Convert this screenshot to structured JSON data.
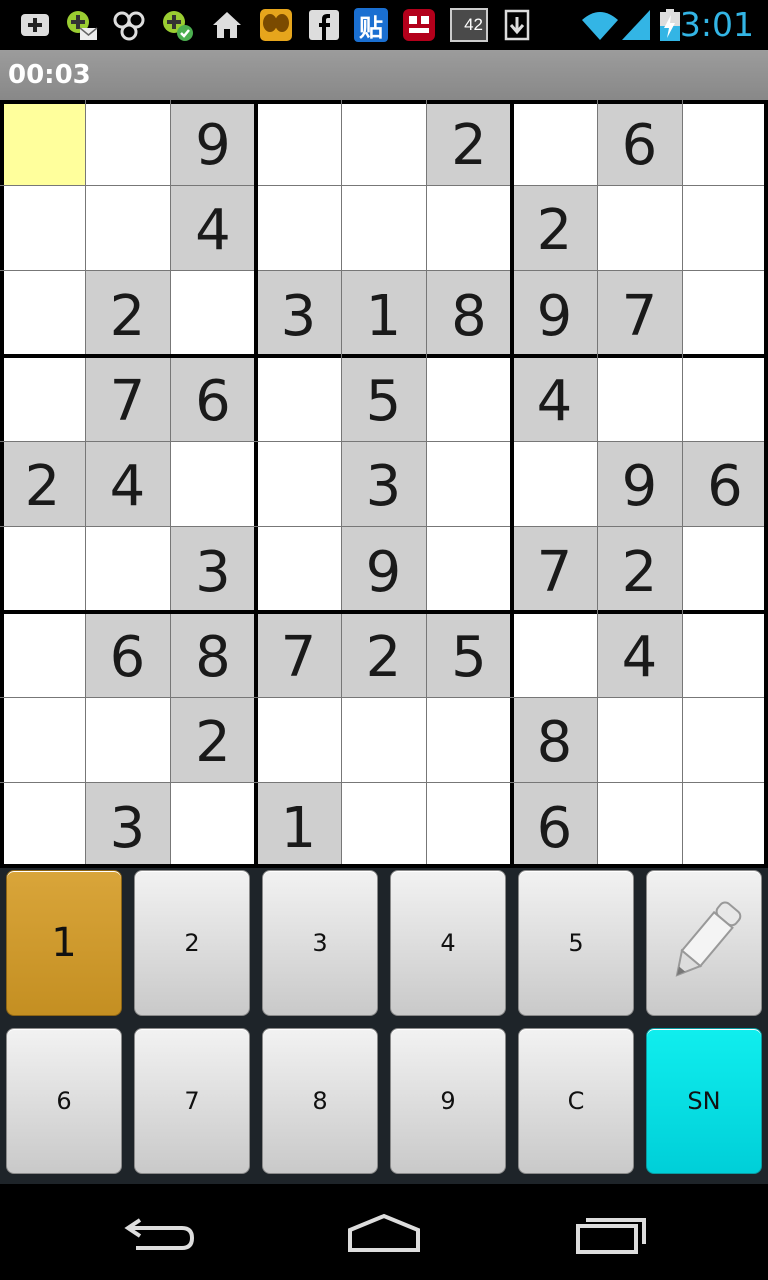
{
  "status_bar": {
    "time": "3:01",
    "notification_icons": [
      "add-box-icon",
      "android-mail-icon",
      "network-link-icon",
      "android-check-icon",
      "home-icon",
      "butterfly-app-icon",
      "facebook-icon",
      "tieba-app-icon",
      "netease-app-icon",
      "battery-widget-icon",
      "download-icon"
    ],
    "widget_text": "42",
    "tieba_text": "贴"
  },
  "timer": {
    "elapsed": "00:03"
  },
  "board": {
    "selected_cell": [
      0,
      0
    ],
    "rows": [
      [
        0,
        0,
        9,
        0,
        0,
        2,
        0,
        6,
        0
      ],
      [
        0,
        0,
        4,
        0,
        0,
        0,
        2,
        0,
        0
      ],
      [
        0,
        2,
        0,
        3,
        1,
        8,
        9,
        7,
        0
      ],
      [
        0,
        7,
        6,
        0,
        5,
        0,
        4,
        0,
        0
      ],
      [
        2,
        4,
        0,
        0,
        3,
        0,
        0,
        9,
        6
      ],
      [
        0,
        0,
        3,
        0,
        9,
        0,
        7,
        2,
        0
      ],
      [
        0,
        6,
        8,
        7,
        2,
        5,
        0,
        4,
        0
      ],
      [
        0,
        0,
        2,
        0,
        0,
        0,
        8,
        0,
        0
      ],
      [
        0,
        3,
        0,
        1,
        0,
        0,
        6,
        0,
        0
      ]
    ]
  },
  "keypad": {
    "row1": [
      "1",
      "2",
      "3",
      "4",
      "5"
    ],
    "row2": [
      "6",
      "7",
      "8",
      "9",
      "C",
      "SN"
    ],
    "active_key": "1",
    "colors": {
      "active": "#c9962c",
      "sn": "#00e5e5"
    }
  },
  "nav": [
    "back-icon",
    "home-icon",
    "recent-apps-icon"
  ]
}
